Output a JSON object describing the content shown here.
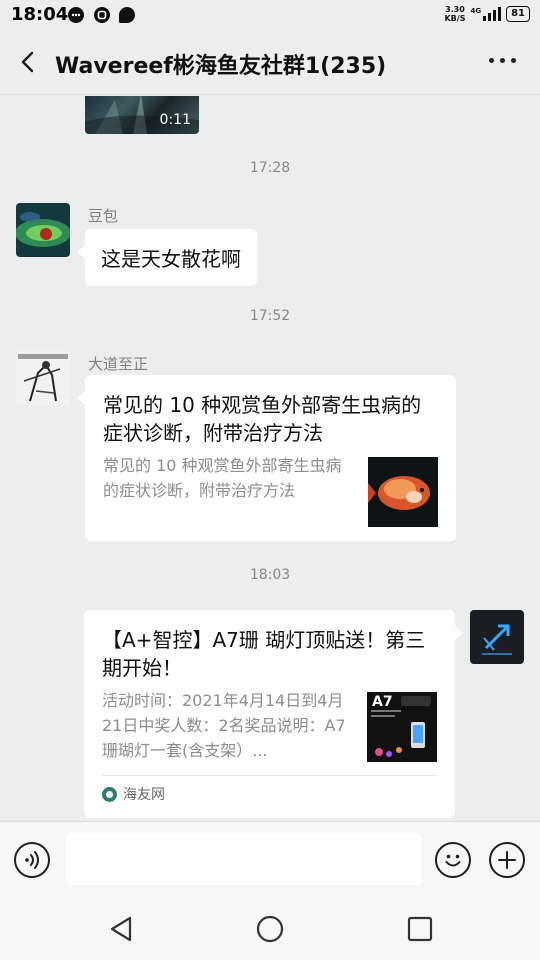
{
  "status_bar": {
    "time": "18:04",
    "net_speed_value": "3.30",
    "net_speed_unit": "KB/S",
    "network": "4G",
    "battery": "81"
  },
  "header": {
    "title": "Wavereef彬海鱼友社群1(235)",
    "back_icon": "chevron-left-icon",
    "more_icon": "more-dots-icon"
  },
  "messages": {
    "video": {
      "duration": "0:11"
    },
    "ts1": "17:28",
    "msg1": {
      "sender": "豆包",
      "text": "这是天女散花啊"
    },
    "ts2": "17:52",
    "msg2": {
      "sender": "大道至正",
      "card_title": "常见的 10 种观赏鱼外部寄生虫病的症状诊断，附带治疗方法",
      "card_desc": "常见的 10 种观赏鱼外部寄生虫病的症状诊断，附带治疗方法"
    },
    "ts3": "18:03",
    "msg3": {
      "card_title": "【A+智控】A7珊 瑚灯顶贴送！第三期开始！",
      "card_desc": "活动时间：2021年4月14日到4月21日中奖人数：2名奖品说明：A7珊瑚灯一套(含支架）...",
      "thumb_label": "A7",
      "source": "海友网"
    }
  },
  "input_bar": {
    "voice_icon": "voice-icon",
    "emoji_icon": "emoji-icon",
    "plus_icon": "plus-icon"
  },
  "nav": {
    "back": "nav-back-icon",
    "home": "nav-home-icon",
    "recents": "nav-recents-icon"
  }
}
